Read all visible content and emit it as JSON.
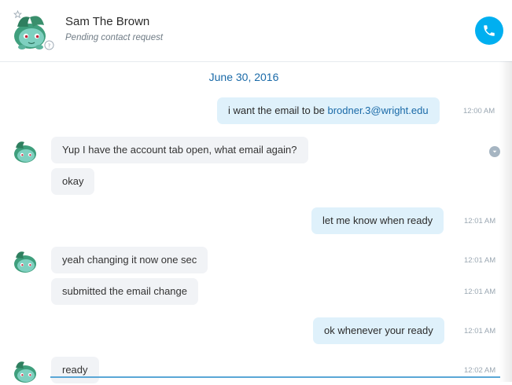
{
  "contact": {
    "name": "Sam The Brown",
    "status": "Pending contact request"
  },
  "date_label": "June 30, 2016",
  "messages": [
    {
      "dir": "out",
      "text": "i want the email to be ",
      "link": "brodner.3@wright.edu",
      "time": "12:00 AM"
    },
    {
      "dir": "in",
      "text": "Yup I have the account tab open, what email again?",
      "time": ""
    },
    {
      "dir": "in",
      "text": "okay",
      "time": ""
    },
    {
      "dir": "out",
      "text": "let me know when ready",
      "time": "12:01 AM"
    },
    {
      "dir": "in",
      "text": "yeah changing it now one sec",
      "time": "12:01 AM"
    },
    {
      "dir": "in",
      "text": "submitted the email change",
      "time": "12:01 AM"
    },
    {
      "dir": "out",
      "text": "ok whenever your ready",
      "time": "12:01 AM"
    },
    {
      "dir": "in",
      "text": "ready",
      "time": "12:02 AM"
    }
  ],
  "colors": {
    "accent": "#00aff0",
    "outgoing_bubble": "#dff1fb",
    "incoming_bubble": "#f1f3f6",
    "link": "#1a6aa8"
  },
  "icons": {
    "call": "phone-icon",
    "favorite": "star-icon",
    "pending": "question-icon",
    "more": "chevron-down-icon"
  }
}
